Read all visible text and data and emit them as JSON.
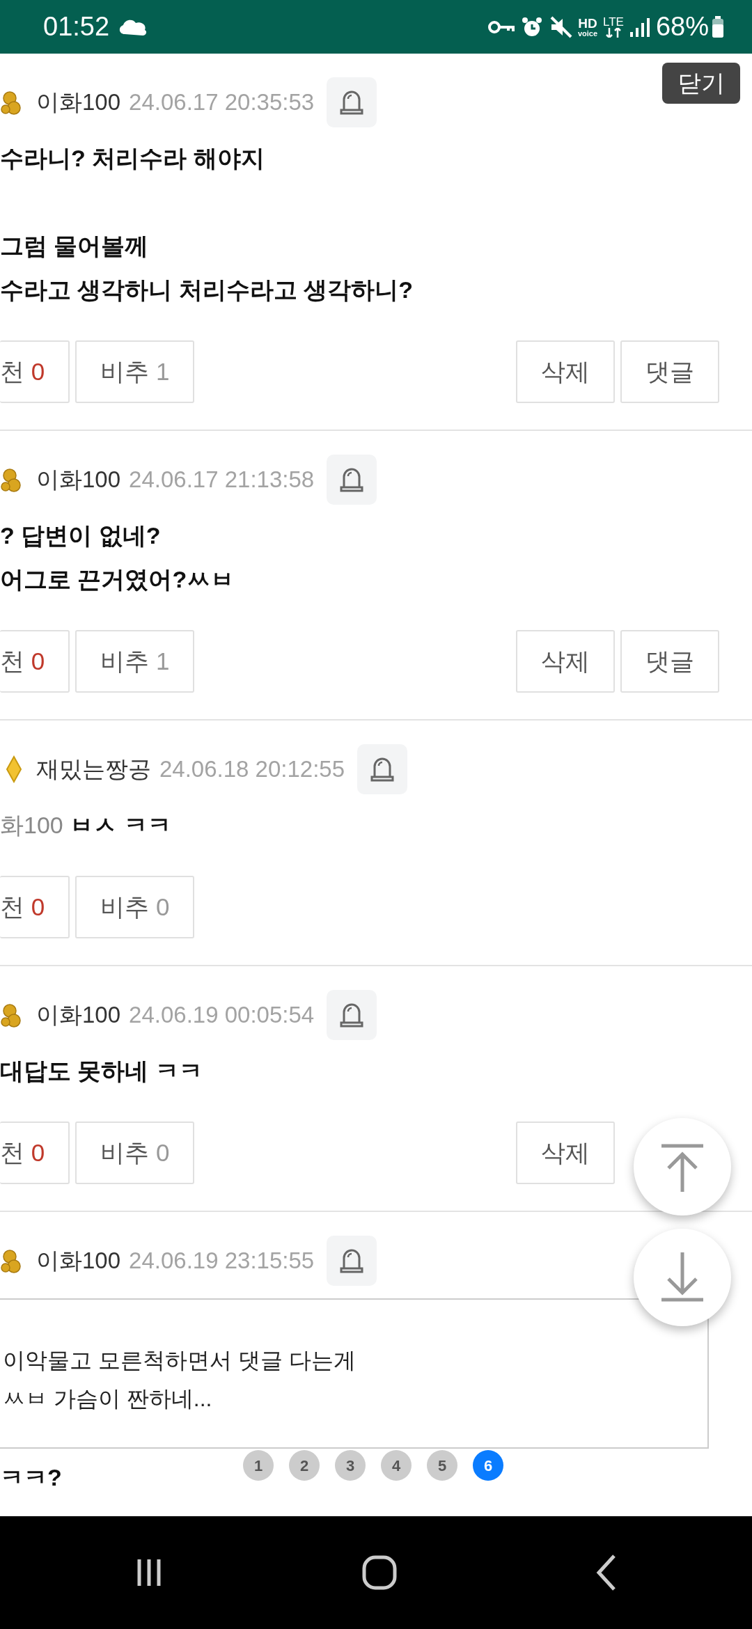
{
  "status_bar": {
    "time": "01:52",
    "hd": "HD",
    "voice": "voice",
    "network": "LTE",
    "battery": "68%"
  },
  "close_button": "닫기",
  "comments": [
    {
      "author": "이화100",
      "kind": "gold",
      "date": "24.06.17 20:35:53",
      "paragraphs": [
        [
          "수라니? 처리수라 해야지"
        ],
        [
          "그럼 물어볼께",
          "수라고 생각하니 처리수라고 생각하니?"
        ]
      ],
      "votes": [
        {
          "kind": "up",
          "label": "천",
          "count": "0"
        },
        {
          "kind": "down",
          "label": "비추",
          "count": "1"
        }
      ],
      "actions": [
        "삭제",
        "댓글"
      ]
    },
    {
      "author": "이화100",
      "kind": "gold",
      "date": "24.06.17 21:13:58",
      "paragraphs": [
        [
          "? 답변이 없네?",
          "어그로 끈거였어?ㅆㅂ"
        ]
      ],
      "votes": [
        {
          "kind": "up",
          "label": "천",
          "count": "0"
        },
        {
          "kind": "down",
          "label": "비추",
          "count": "1"
        }
      ],
      "actions": [
        "삭제",
        "댓글"
      ]
    },
    {
      "author": "재밌는짱공",
      "kind": "diamond",
      "date": "24.06.18 20:12:55",
      "mention": "화100",
      "paragraphs": [
        [
          "ㅂㅅ ㅋㅋ"
        ]
      ],
      "votes": [
        {
          "kind": "up",
          "label": "천",
          "count": "0"
        },
        {
          "kind": "down",
          "label": "비추",
          "count": "0"
        }
      ]
    },
    {
      "author": "이화100",
      "kind": "gold",
      "date": "24.06.19 00:05:54",
      "paragraphs": [
        [
          "대답도 못하네 ㅋㅋ"
        ]
      ],
      "votes": [
        {
          "kind": "up",
          "label": "천",
          "count": "0"
        },
        {
          "kind": "down",
          "label": "비추",
          "count": "0"
        }
      ],
      "actions": [
        "삭제"
      ]
    },
    {
      "author": "이화100",
      "kind": "gold",
      "date": "24.06.19 23:15:55",
      "quote": [
        "이악물고 모른척하면서 댓글 다는게",
        "ㅆㅂ 가슴이 짠하네..."
      ],
      "paragraphs": [
        [
          "ㅋㅋ?"
        ]
      ]
    }
  ],
  "pagination": [
    {
      "label": "1",
      "selected": false
    },
    {
      "label": "2",
      "selected": false
    },
    {
      "label": "3",
      "selected": false
    },
    {
      "label": "4",
      "selected": false
    },
    {
      "label": "5",
      "selected": false
    },
    {
      "label": "6",
      "selected": true
    }
  ]
}
